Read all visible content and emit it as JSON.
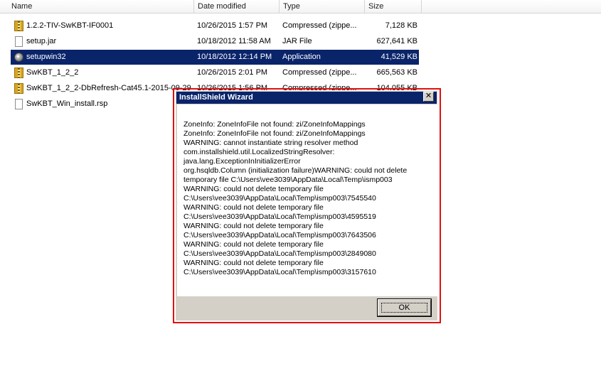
{
  "columns": {
    "name": "Name",
    "date": "Date modified",
    "type": "Type",
    "size": "Size"
  },
  "files": [
    {
      "name": "1.2.2-TIV-SwKBT-IF0001",
      "date": "10/26/2015 1:57 PM",
      "type": "Compressed (zippe...",
      "size": "7,128 KB",
      "icon": "zip-folder-icon"
    },
    {
      "name": "setup.jar",
      "date": "10/18/2012 11:58 AM",
      "type": "JAR File",
      "size": "627,641 KB",
      "icon": "file-icon"
    },
    {
      "name": "setupwin32",
      "date": "10/18/2012 12:14 PM",
      "type": "Application",
      "size": "41,529 KB",
      "icon": "application-icon"
    },
    {
      "name": "SwKBT_1_2_2",
      "date": "10/26/2015 2:01 PM",
      "type": "Compressed (zippe...",
      "size": "665,563 KB",
      "icon": "zip-folder-icon"
    },
    {
      "name": "SwKBT_1_2_2-DbRefresh-Cat45.1-2015-09-29",
      "date": "10/26/2015 1:56 PM",
      "type": "Compressed (zippe...",
      "size": "104,055 KB",
      "icon": "zip-folder-icon"
    },
    {
      "name": "SwKBT_Win_install.rsp",
      "date": "",
      "type": "",
      "size": "",
      "icon": "file-icon"
    }
  ],
  "selected_index": 2,
  "dialog": {
    "title": "InstallShield Wizard",
    "close_glyph": "✕",
    "message": "ZoneInfo: ZoneInfoFile not found: zi/ZoneInfoMappings\nZoneInfo: ZoneInfoFile not found: zi/ZoneInfoMappings\nWARNING: cannot instantiate string resolver method\ncom.installshield.util.LocalizedStringResolver:\njava.lang.ExceptionInInitializerError\norg.hsqldb.Column (initialization failure)WARNING: could not delete\ntemporary file C:\\Users\\vee3039\\AppData\\Local\\Temp\\ismp003\nWARNING: could not delete temporary file\nC:\\Users\\vee3039\\AppData\\Local\\Temp\\ismp003\\7545540\nWARNING: could not delete temporary file\nC:\\Users\\vee3039\\AppData\\Local\\Temp\\ismp003\\4595519\nWARNING: could not delete temporary file\nC:\\Users\\vee3039\\AppData\\Local\\Temp\\ismp003\\7643506\nWARNING: could not delete temporary file\nC:\\Users\\vee3039\\AppData\\Local\\Temp\\ismp003\\2849080\nWARNING: could not delete temporary file\nC:\\Users\\vee3039\\AppData\\Local\\Temp\\ismp003\\3157610",
    "ok_label": "OK"
  },
  "colors": {
    "selection": "#0a246a",
    "titlebar": "#0a246a",
    "highlight_outline": "#e01010",
    "dialog_face": "#d4d0c8"
  }
}
